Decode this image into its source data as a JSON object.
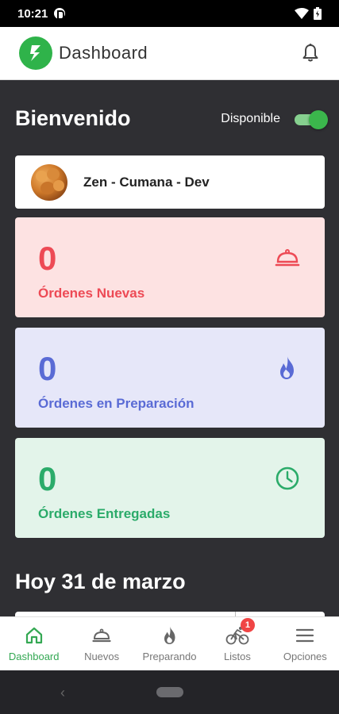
{
  "status_bar": {
    "time": "10:21"
  },
  "app_bar": {
    "title": "Dashboard"
  },
  "welcome": {
    "title": "Bienvenido",
    "available_label": "Disponible",
    "available": true
  },
  "store": {
    "name": "Zen - Cumana - Dev"
  },
  "stats": [
    {
      "value": "0",
      "label": "Órdenes Nuevas",
      "icon": "cloche-icon",
      "color": "#ed4a55"
    },
    {
      "value": "0",
      "label": "Órdenes en Preparación",
      "icon": "flame-icon",
      "color": "#5a6bd5"
    },
    {
      "value": "0",
      "label": "Órdenes Entregadas",
      "icon": "clock-icon",
      "color": "#2bab6a"
    }
  ],
  "date_title": "Hoy 31 de marzo",
  "bottom_nav": [
    {
      "label": "Dashboard",
      "icon": "home-icon",
      "active": true
    },
    {
      "label": "Nuevos",
      "icon": "cloche-icon",
      "active": false
    },
    {
      "label": "Preparando",
      "icon": "flame-icon",
      "active": false
    },
    {
      "label": "Listos",
      "icon": "bicycle-icon",
      "active": false,
      "badge": "1"
    },
    {
      "label": "Opciones",
      "icon": "menu-icon",
      "active": false
    }
  ],
  "colors": {
    "accent": "#34a853",
    "background": "#2f2f33"
  }
}
